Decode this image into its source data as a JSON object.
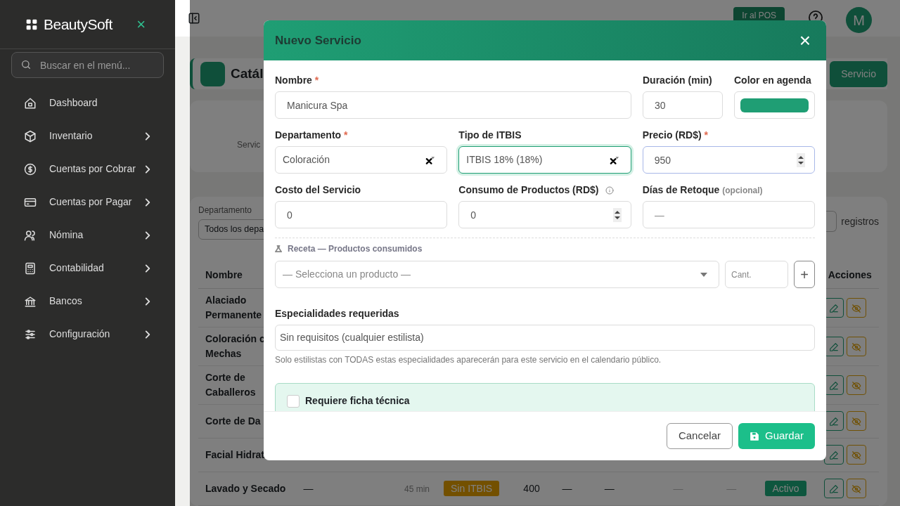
{
  "sidebar": {
    "brand": "BeautySoft",
    "close": "×",
    "search": {
      "placeholder": "Buscar en el menú..."
    },
    "items": [
      {
        "label": "Dashboard",
        "has_submenu": false
      },
      {
        "label": "Inventario",
        "has_submenu": true
      },
      {
        "label": "Cuentas por Cobrar",
        "has_submenu": true
      },
      {
        "label": "Cuentas por Pagar",
        "has_submenu": true
      },
      {
        "label": "Nómina",
        "has_submenu": true
      },
      {
        "label": "Contabilidad",
        "has_submenu": true
      },
      {
        "label": "Bancos",
        "has_submenu": true
      },
      {
        "label": "Configuración",
        "has_submenu": true
      }
    ]
  },
  "topbar": {
    "pos_button": "Ir al POS",
    "avatar": "M"
  },
  "page": {
    "title": "Catál",
    "new_button": "Servicio",
    "stats_label": "Servic",
    "filter": {
      "label": "Departamento",
      "value": "Todos los depa"
    },
    "registros": "registros",
    "columns": [
      "Nombre",
      "Acciones"
    ],
    "rows": [
      {
        "name": "Alaciado Permanente",
        "cells": []
      },
      {
        "name": "Coloración c Mechas",
        "cells": []
      },
      {
        "name": "Corte de Caballeros",
        "cells": []
      },
      {
        "name": "Corte de Da",
        "cells": []
      },
      {
        "name": "Facial Hidrat",
        "cells": []
      },
      {
        "name": "Lavado y Secado",
        "cells": [
          {
            "text": "—",
            "kind": "plain"
          },
          {
            "text": "45 min",
            "kind": "muted"
          },
          {
            "text": "Sin ITBIS",
            "kind": "warning"
          },
          {
            "text": "400",
            "kind": "plain"
          },
          {
            "text": "—",
            "kind": "plain"
          },
          {
            "text": "—",
            "kind": "plain"
          },
          {
            "text": "—",
            "kind": "faint"
          },
          {
            "text": "—",
            "kind": "faint"
          },
          {
            "text": "Activo",
            "kind": "success"
          }
        ]
      }
    ]
  },
  "modal": {
    "title": "Nuevo Servicio",
    "close": "×",
    "rows": [
      {
        "kind": "wide-first",
        "fields": [
          {
            "label": "Nombre",
            "required_mark": "*",
            "kind": "text",
            "value": "Manicura Spa",
            "focused": false,
            "highlighted": false
          },
          {
            "label": "Duración (min)",
            "kind": "text",
            "value": "30",
            "focused": false,
            "highlighted": false
          },
          {
            "label": "Color en agenda",
            "kind": "color",
            "color": "#1f9e74",
            "focused": false,
            "highlighted": false
          }
        ]
      },
      {
        "kind": "equal",
        "fields": [
          {
            "label": "Departamento",
            "required_mark": "*",
            "kind": "select",
            "value": "Coloración",
            "clearable": true,
            "focused": false,
            "highlighted": false
          },
          {
            "label": "Tipo de ITBIS",
            "kind": "select",
            "value": "ITBIS 18% (18%)",
            "clearable": true,
            "focused": true,
            "highlighted": false
          },
          {
            "label": "Precio (RD$)",
            "required_mark": "*",
            "kind": "number",
            "value": "950",
            "focused": false,
            "highlighted": true
          }
        ]
      },
      {
        "kind": "equal",
        "fields": [
          {
            "label": "Costo del Servicio",
            "kind": "text",
            "value": "0",
            "focused": false,
            "highlighted": false
          },
          {
            "label": "Consumo de Productos (RD$)",
            "info": true,
            "kind": "number",
            "value": "0",
            "focused": false,
            "highlighted": false
          },
          {
            "label": "Días de Retoque",
            "optional_note": "(opcional)",
            "kind": "text",
            "placeholder": "—",
            "focused": false,
            "highlighted": false
          }
        ]
      }
    ],
    "recipe": {
      "label": "Receta — Productos consumidos",
      "product": {
        "placeholder": "— Selecciona un producto —"
      },
      "qty": {
        "placeholder": "Cant."
      },
      "add": "+"
    },
    "specialties": {
      "label": "Especialidades requeridas",
      "value": "Sin requisitos (cualquier estilista)",
      "help": "Solo estilistas con TODAS estas especialidades aparecerán para este servicio en el calendario público."
    },
    "ficha": {
      "label": "Requiere ficha técnica",
      "checked": false
    },
    "cancel": "Cancelar",
    "save": "Guardar"
  }
}
